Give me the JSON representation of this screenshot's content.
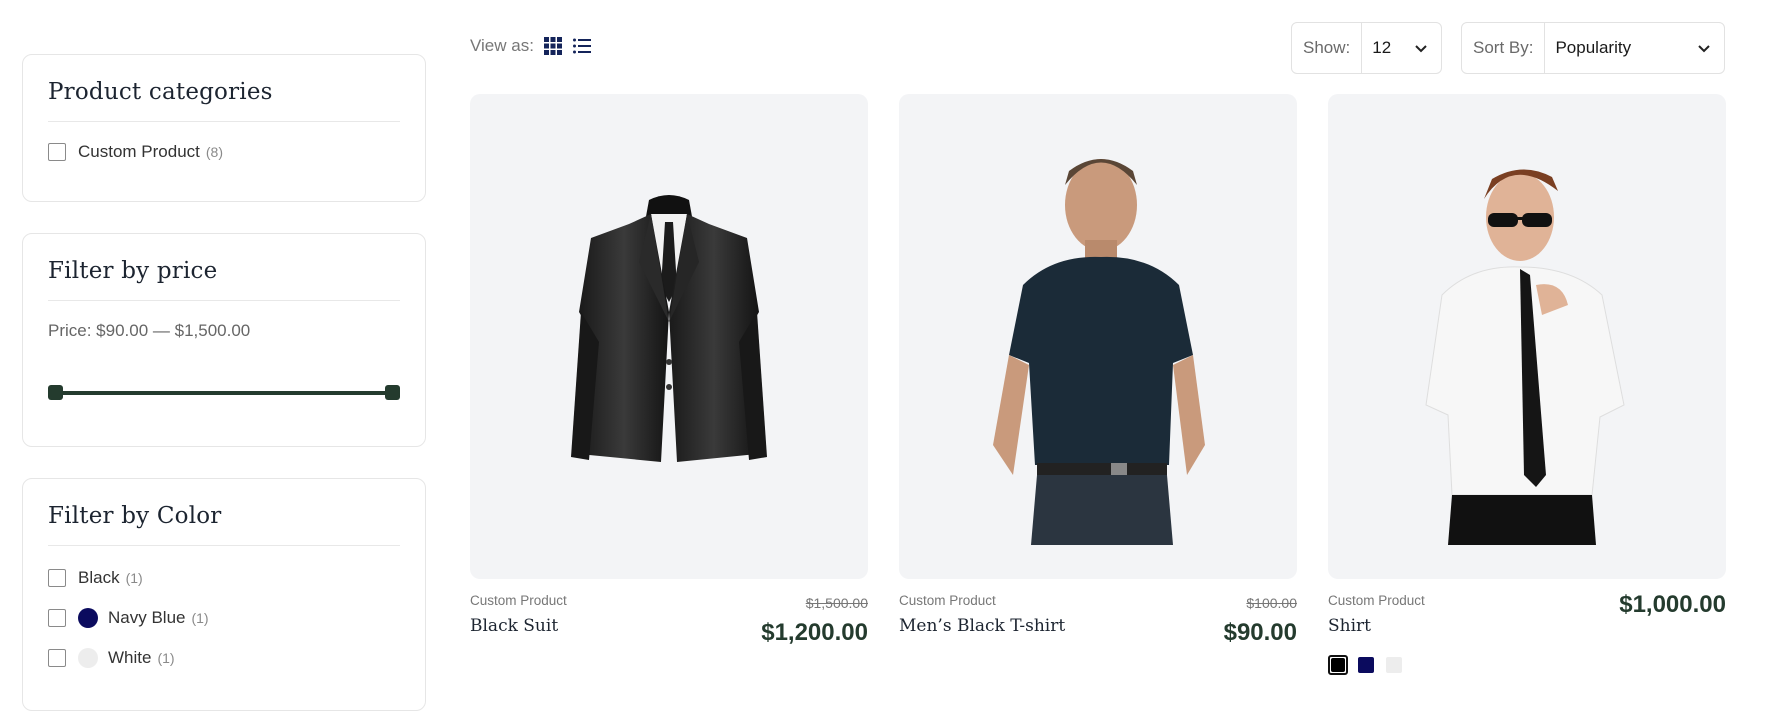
{
  "sidebar": {
    "categories": {
      "title": "Product categories",
      "items": [
        {
          "label": "Custom Product",
          "count": "(8)"
        }
      ]
    },
    "price": {
      "title": "Filter by price",
      "label": "Price: $90.00 — $1,500.00",
      "range_min_fraction": 0,
      "range_max_fraction": 1
    },
    "color": {
      "title": "Filter by Color",
      "items": [
        {
          "label": "Black",
          "count": "(1)",
          "dot": ""
        },
        {
          "label": "Navy Blue",
          "count": "(1)",
          "dot": "#0b0b5e"
        },
        {
          "label": "White",
          "count": "(1)",
          "dot": "#ededed"
        }
      ]
    }
  },
  "toolbar": {
    "view_as": "View as:",
    "show_label": "Show:",
    "show_value": "12",
    "sort_label": "Sort By:",
    "sort_value": "Popularity"
  },
  "products": [
    {
      "category": "Custom Product",
      "name": "Black Suit",
      "old_price": "$1,500.00",
      "price": "$1,200.00",
      "image": "black-suit-jacket"
    },
    {
      "category": "Custom Product",
      "name": "Men’s Black T-shirt",
      "old_price": "$100.00",
      "price": "$90.00",
      "image": "man-in-dark-tshirt"
    },
    {
      "category": "Custom Product",
      "name": "Shirt",
      "old_price": "",
      "price": "$1,000.00",
      "image": "man-in-white-shirt-tie",
      "swatches": [
        {
          "color": "#000000",
          "selected": true
        },
        {
          "color": "#0b0b5e",
          "selected": false
        },
        {
          "color": "#ededed",
          "selected": false
        }
      ]
    }
  ],
  "colors": {
    "accent": "#243b2e",
    "image_bg": "#f3f4f6",
    "grid_icon": "#14245a"
  }
}
